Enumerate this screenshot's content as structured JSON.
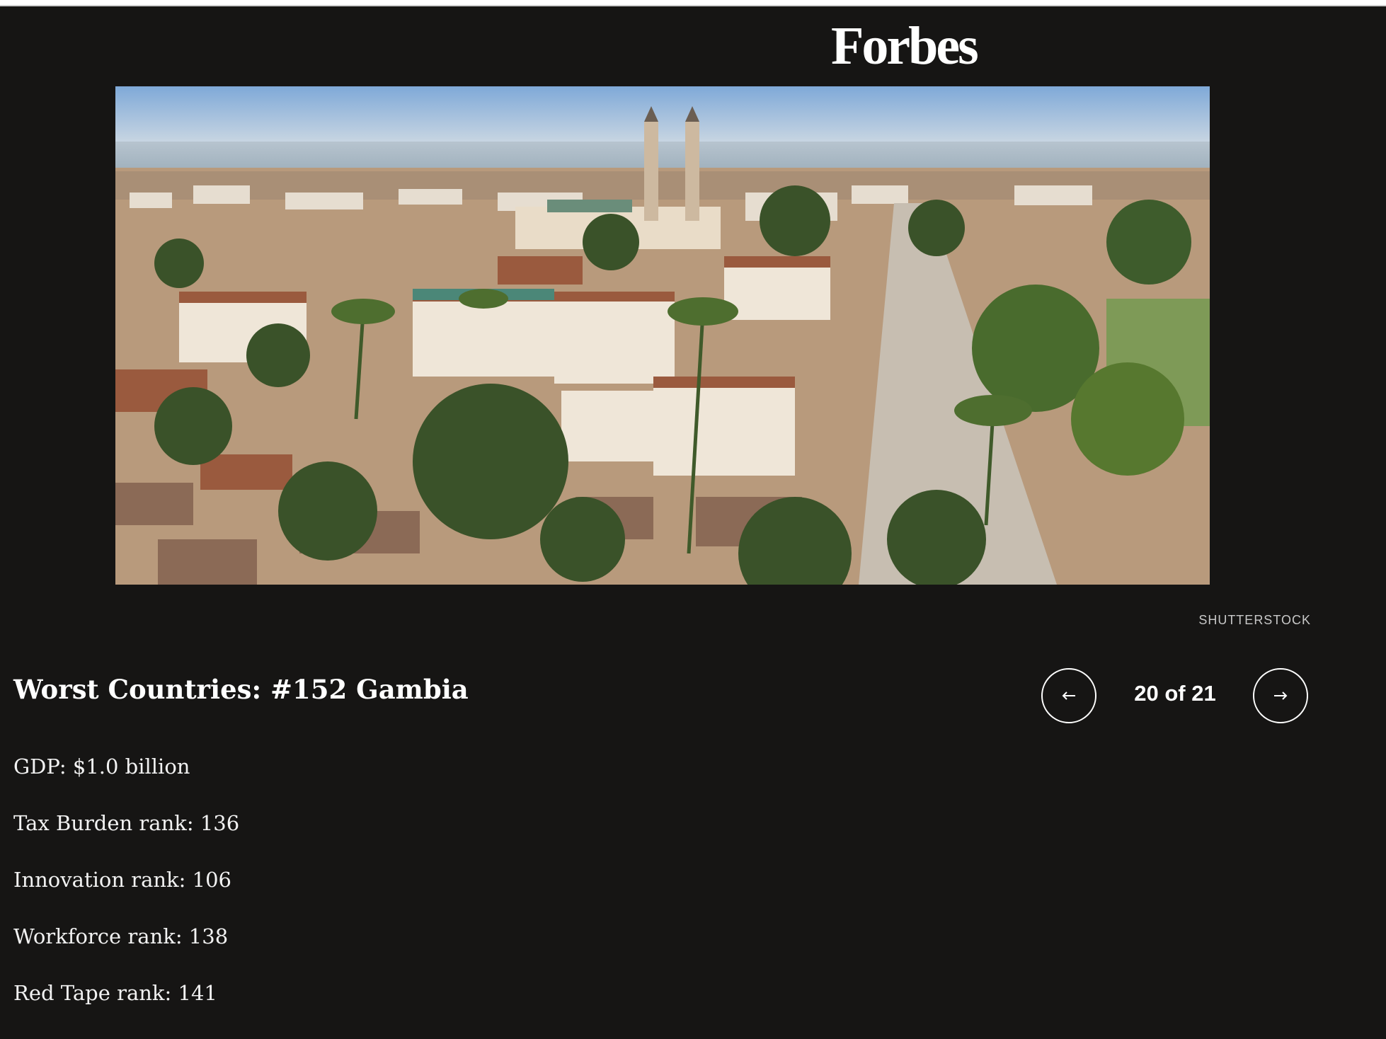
{
  "brand": {
    "logo_text": "Forbes"
  },
  "image": {
    "alt": "Aerial view of Banjul, Gambia with mosque minarets, rooftops, palm trees and the river in the distance",
    "credit": "SHUTTERSTOCK"
  },
  "slide": {
    "title": "Worst Countries: #152 Gambia",
    "counter": "20 of 21",
    "stats": [
      "GDP: $1.0 billion",
      "Tax Burden rank: 136",
      "Innovation rank: 106",
      "Workforce rank: 138",
      "Red Tape rank: 141"
    ]
  },
  "navigation": {
    "prev_icon": "arrow-left-icon",
    "next_icon": "arrow-right-icon"
  },
  "colors": {
    "background": "#161514",
    "text": "#ffffff"
  }
}
